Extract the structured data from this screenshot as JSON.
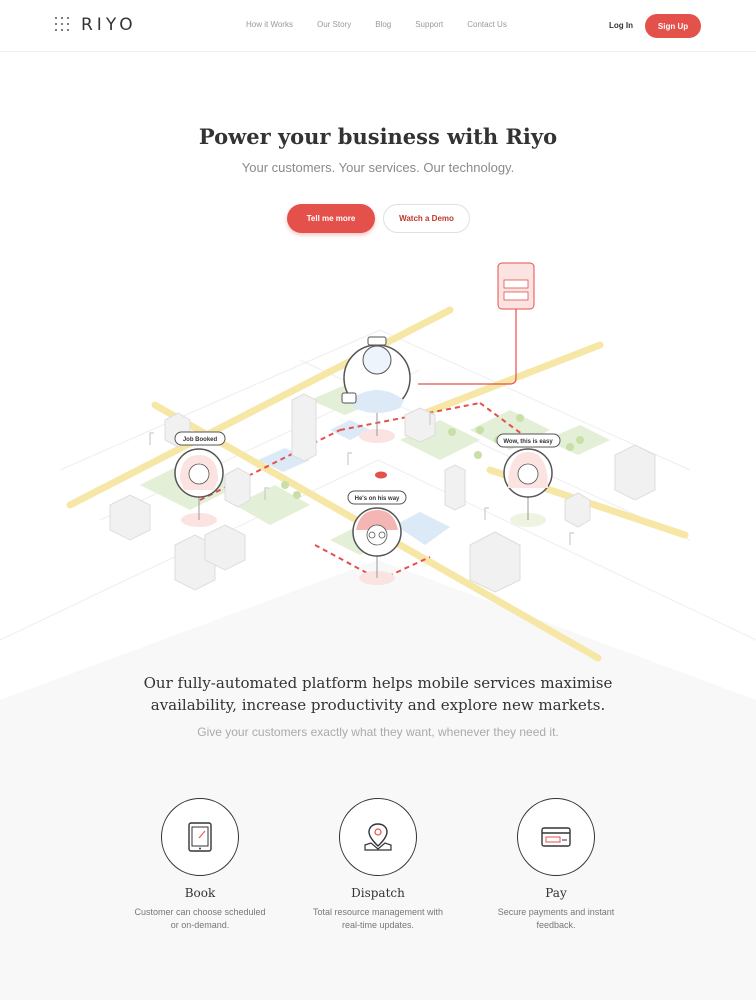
{
  "brand": {
    "name": "RIYO",
    "accent": "#e4504a"
  },
  "nav": {
    "links": [
      "How it Works",
      "Our Story",
      "Blog",
      "Support",
      "Contact Us"
    ],
    "login": "Log In",
    "signup": "Sign Up"
  },
  "hero": {
    "title": "Power your business with Riyo",
    "subtitle": "Your customers. Your services. Our technology.",
    "primary_cta": "Tell me more",
    "secondary_cta": "Watch a Demo"
  },
  "illustration": {
    "bubbles": {
      "job_booked": "Job Booked",
      "on_his_way": "He's on his way",
      "wow": "Wow, this is easy"
    }
  },
  "platform": {
    "headline_line1": "Our fully-automated platform helps mobile services maximise",
    "headline_line2": "availability, increase productivity and explore new markets.",
    "subtext": "Give your customers exactly what they want, whenever they need it."
  },
  "features": [
    {
      "icon": "tablet-icon",
      "title": "Book",
      "desc": "Customer can choose scheduled or on-demand."
    },
    {
      "icon": "location-pin-icon",
      "title": "Dispatch",
      "desc": "Total resource management with real-time updates."
    },
    {
      "icon": "credit-card-icon",
      "title": "Pay",
      "desc": "Secure payments and instant feedback."
    }
  ]
}
